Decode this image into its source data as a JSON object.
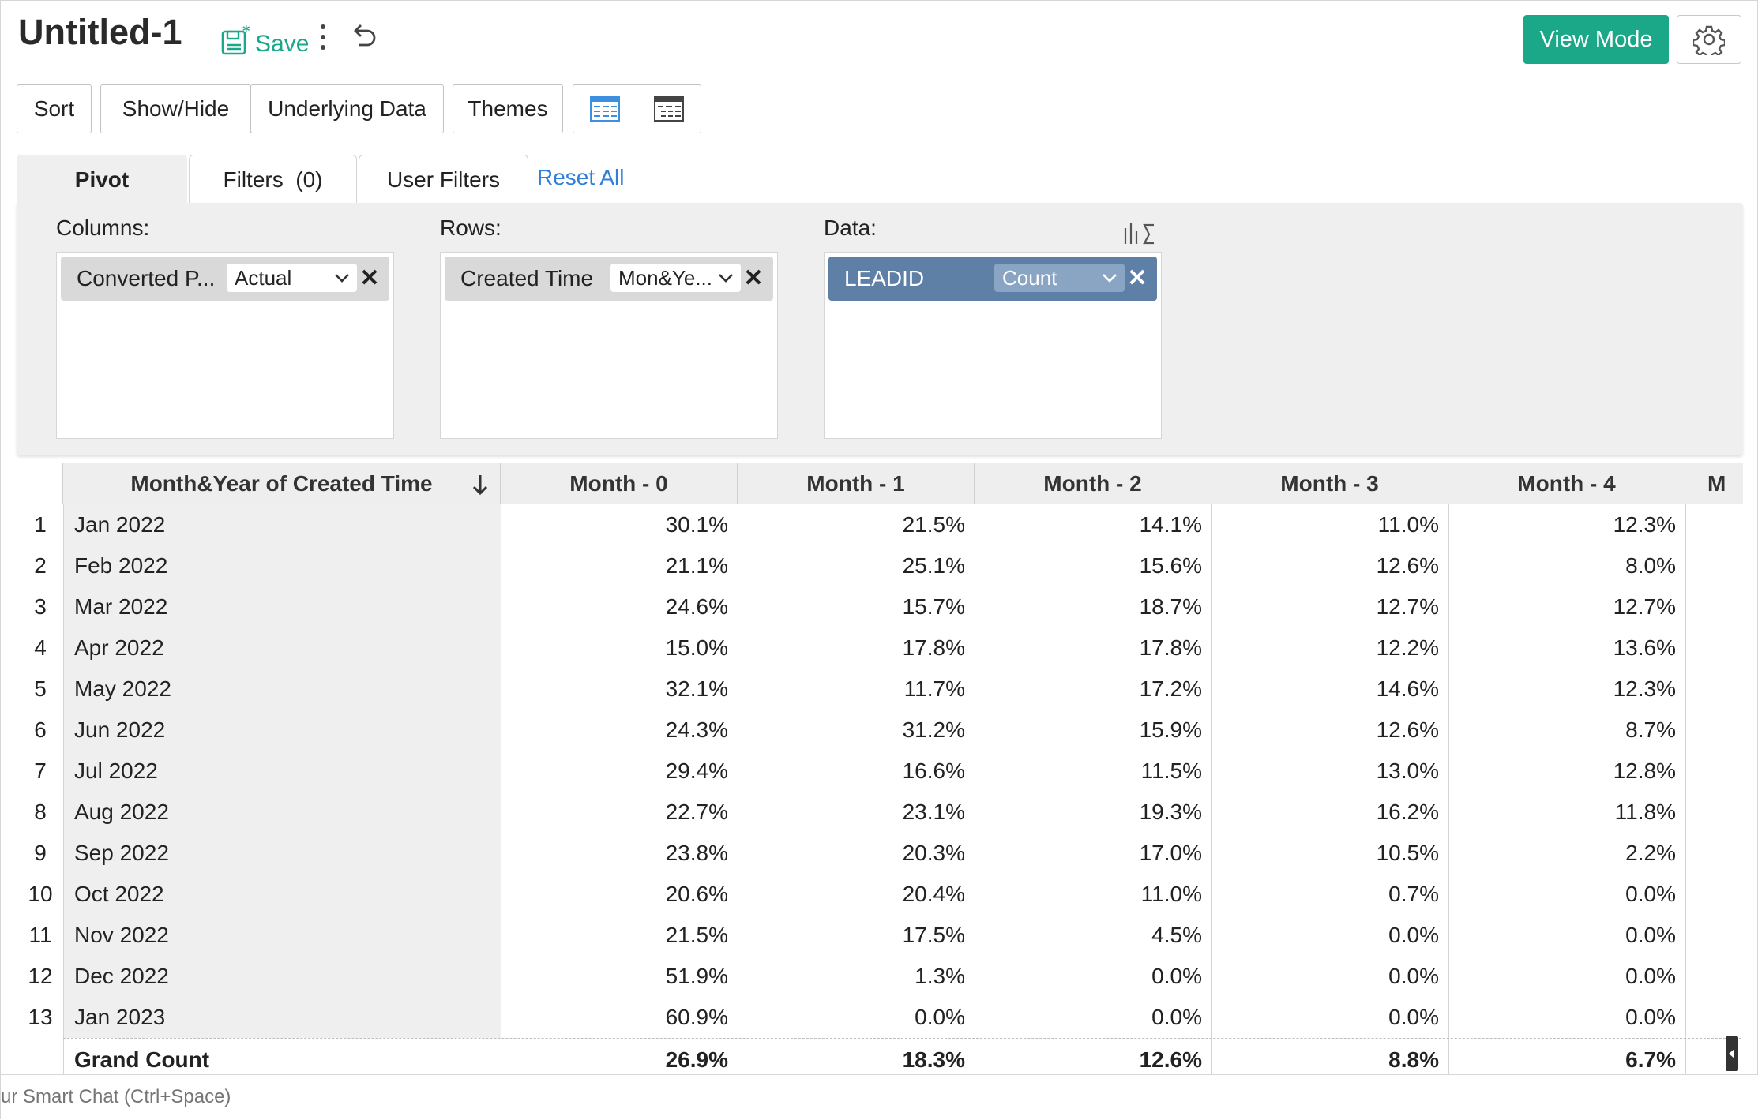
{
  "header": {
    "title": "Untitled-1",
    "save_label": "Save",
    "view_mode_label": "View Mode"
  },
  "toolbar": {
    "sort": "Sort",
    "show_hide": "Show/Hide",
    "underlying_data": "Underlying Data",
    "themes": "Themes"
  },
  "tabs": {
    "pivot": "Pivot",
    "filters": "Filters  (0)",
    "user_filters": "User Filters",
    "reset_all": "Reset All"
  },
  "pivot": {
    "columns_label": "Columns:",
    "rows_label": "Rows:",
    "data_label": "Data:",
    "column_field": {
      "label": "Converted P...",
      "function": "Actual"
    },
    "row_field": {
      "label": "Created Time",
      "function": "Mon&Ye..."
    },
    "data_field": {
      "label": "LEADID",
      "function": "Count"
    }
  },
  "table": {
    "first_header": "Month&Year of Created Time",
    "headers": [
      "Month - 0",
      "Month - 1",
      "Month - 2",
      "Month - 3",
      "Month - 4",
      "M"
    ],
    "rows": [
      {
        "n": "1",
        "label": "Jan 2022",
        "values": [
          "30.1%",
          "21.5%",
          "14.1%",
          "11.0%",
          "12.3%"
        ]
      },
      {
        "n": "2",
        "label": "Feb 2022",
        "values": [
          "21.1%",
          "25.1%",
          "15.6%",
          "12.6%",
          "8.0%"
        ]
      },
      {
        "n": "3",
        "label": "Mar 2022",
        "values": [
          "24.6%",
          "15.7%",
          "18.7%",
          "12.7%",
          "12.7%"
        ]
      },
      {
        "n": "4",
        "label": "Apr 2022",
        "values": [
          "15.0%",
          "17.8%",
          "17.8%",
          "12.2%",
          "13.6%"
        ]
      },
      {
        "n": "5",
        "label": "May 2022",
        "values": [
          "32.1%",
          "11.7%",
          "17.2%",
          "14.6%",
          "12.3%"
        ]
      },
      {
        "n": "6",
        "label": "Jun 2022",
        "values": [
          "24.3%",
          "31.2%",
          "15.9%",
          "12.6%",
          "8.7%"
        ]
      },
      {
        "n": "7",
        "label": "Jul 2022",
        "values": [
          "29.4%",
          "16.6%",
          "11.5%",
          "13.0%",
          "12.8%"
        ]
      },
      {
        "n": "8",
        "label": "Aug 2022",
        "values": [
          "22.7%",
          "23.1%",
          "19.3%",
          "16.2%",
          "11.8%"
        ]
      },
      {
        "n": "9",
        "label": "Sep 2022",
        "values": [
          "23.8%",
          "20.3%",
          "17.0%",
          "10.5%",
          "2.2%"
        ]
      },
      {
        "n": "10",
        "label": "Oct 2022",
        "values": [
          "20.6%",
          "20.4%",
          "11.0%",
          "0.7%",
          "0.0%"
        ]
      },
      {
        "n": "11",
        "label": "Nov 2022",
        "values": [
          "21.5%",
          "17.5%",
          "4.5%",
          "0.0%",
          "0.0%"
        ]
      },
      {
        "n": "12",
        "label": "Dec 2022",
        "values": [
          "51.9%",
          "1.3%",
          "0.0%",
          "0.0%",
          "0.0%"
        ]
      },
      {
        "n": "13",
        "label": "Jan 2023",
        "values": [
          "60.9%",
          "0.0%",
          "0.0%",
          "0.0%",
          "0.0%"
        ]
      }
    ],
    "grand": {
      "label": "Grand Count",
      "values": [
        "26.9%",
        "18.3%",
        "12.6%",
        "8.8%",
        "6.7%"
      ]
    }
  },
  "chat": {
    "placeholder": "ur Smart Chat (Ctrl+Space)"
  },
  "colors": {
    "accent": "#1ba889",
    "link": "#2e7fd9",
    "data_chip": "#5e7fa6"
  }
}
